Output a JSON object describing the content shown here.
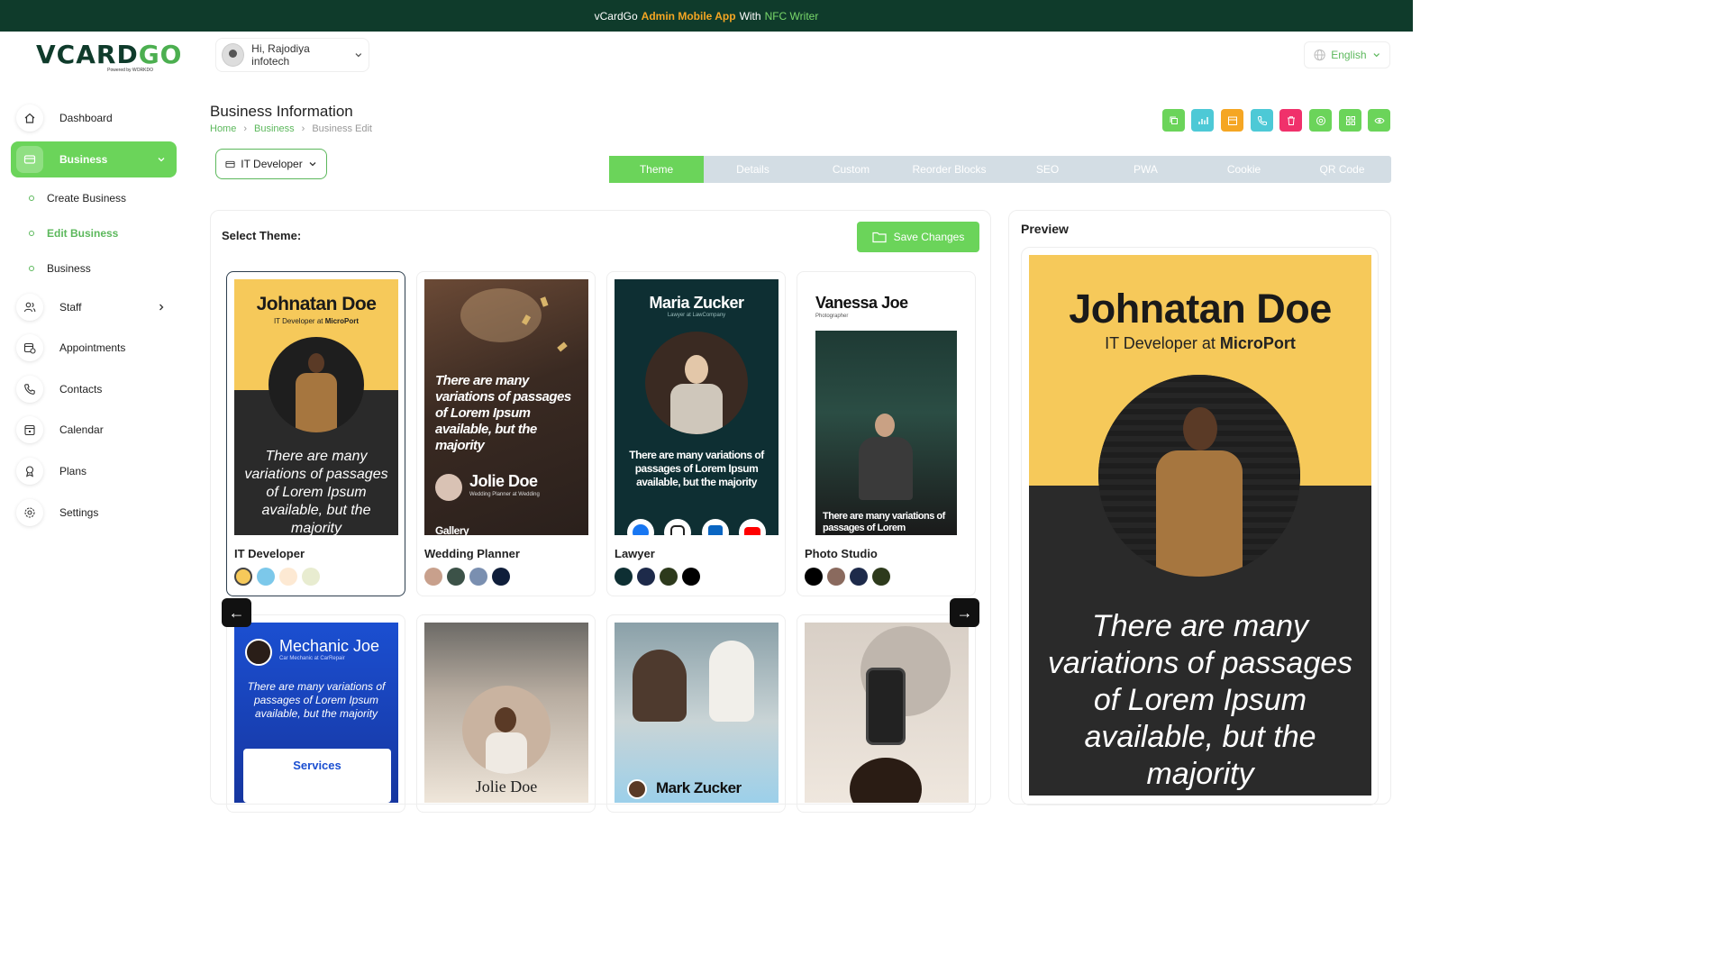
{
  "banner": {
    "pre": "vCardGo",
    "highlight1": "Admin Mobile App",
    "mid": "With",
    "highlight2": "NFC Writer"
  },
  "logo": {
    "text_a": "VCARD",
    "text_b": "GO",
    "sub": "Powered by WORKDO"
  },
  "user": {
    "greeting": "Hi, Rajodiya infotech"
  },
  "language": {
    "label": "English"
  },
  "sidebar": {
    "items": [
      {
        "label": "Dashboard"
      },
      {
        "label": "Business"
      },
      {
        "label": "Staff"
      },
      {
        "label": "Appointments"
      },
      {
        "label": "Contacts"
      },
      {
        "label": "Calendar"
      },
      {
        "label": "Plans"
      },
      {
        "label": "Settings"
      }
    ],
    "sub_items": [
      {
        "label": "Create Business"
      },
      {
        "label": "Edit Business"
      },
      {
        "label": "Business"
      }
    ]
  },
  "page": {
    "title": "Business Information",
    "breadcrumb": [
      "Home",
      "Business",
      "Business Edit"
    ]
  },
  "action_buttons": [
    {
      "icon": "copy-icon",
      "color": "#6bd45a"
    },
    {
      "icon": "analytics-icon",
      "color": "#4dc9d6"
    },
    {
      "icon": "calendar-icon",
      "color": "#f5a623"
    },
    {
      "icon": "phone-icon",
      "color": "#4dc9d6"
    },
    {
      "icon": "trash-icon",
      "color": "#f0316b"
    },
    {
      "icon": "nfc-icon",
      "color": "#6bd45a"
    },
    {
      "icon": "qr-icon",
      "color": "#6bd45a"
    },
    {
      "icon": "eye-icon",
      "color": "#6bd45a"
    }
  ],
  "business_select": {
    "value": "IT Developer"
  },
  "tabs": [
    "Theme",
    "Details",
    "Custom",
    "Reorder Blocks",
    "SEO",
    "PWA",
    "Cookie",
    "QR Code"
  ],
  "theme_section": {
    "label": "Select Theme:",
    "save_label": "Save Changes"
  },
  "themes": [
    {
      "name": "IT Developer",
      "thumb_name": "Johnatan Doe",
      "thumb_role": "IT Developer at",
      "thumb_company": "MicroPort",
      "thumb_quote": "There are many variations of passages of Lorem Ipsum available, but the majority",
      "swatches": [
        "#f6c95a",
        "#7cc8ea",
        "#fde9d3",
        "#e8ecd0"
      ]
    },
    {
      "name": "Wedding Planner",
      "thumb_name": "Jolie Doe",
      "thumb_role": "Wedding Planner at Wedding",
      "thumb_quote": "There are many variations of passages of Lorem Ipsum available, but the majority",
      "thumb_footer": "Gallery",
      "swatches": [
        "#c8a08c",
        "#3c5248",
        "#7a8fb0",
        "#0f1e3a"
      ]
    },
    {
      "name": "Lawyer",
      "thumb_name": "Maria Zucker",
      "thumb_role": "Lawyer at LawCompany",
      "thumb_quote": "There are many variations of passages of Lorem Ipsum available, but the majority",
      "swatches": [
        "#0e2f33",
        "#1d2a4a",
        "#2d3a1c",
        "#000000"
      ]
    },
    {
      "name": "Photo Studio",
      "thumb_name": "Vanessa Joe",
      "thumb_role": "Photographer",
      "thumb_quote": "There are many variations of passages of Lorem",
      "swatches": [
        "#000000",
        "#8a6a5e",
        "#1d2a4a",
        "#2d3a1c"
      ]
    }
  ],
  "themes_row2": [
    {
      "thumb_name": "Mechanic Joe",
      "thumb_role": "Car Mechanic at CarRepair",
      "thumb_quote": "There are many variations of passages of Lorem Ipsum available, but the majority",
      "thumb_section": "Services"
    },
    {
      "thumb_name": "Jolie Doe"
    },
    {
      "thumb_name": "Mark Zucker"
    },
    {}
  ],
  "preview": {
    "label": "Preview",
    "name": "Johnatan Doe",
    "role": "IT Developer at",
    "company": "MicroPort",
    "quote": "There are many variations of passages of Lorem Ipsum available, but the majority"
  }
}
